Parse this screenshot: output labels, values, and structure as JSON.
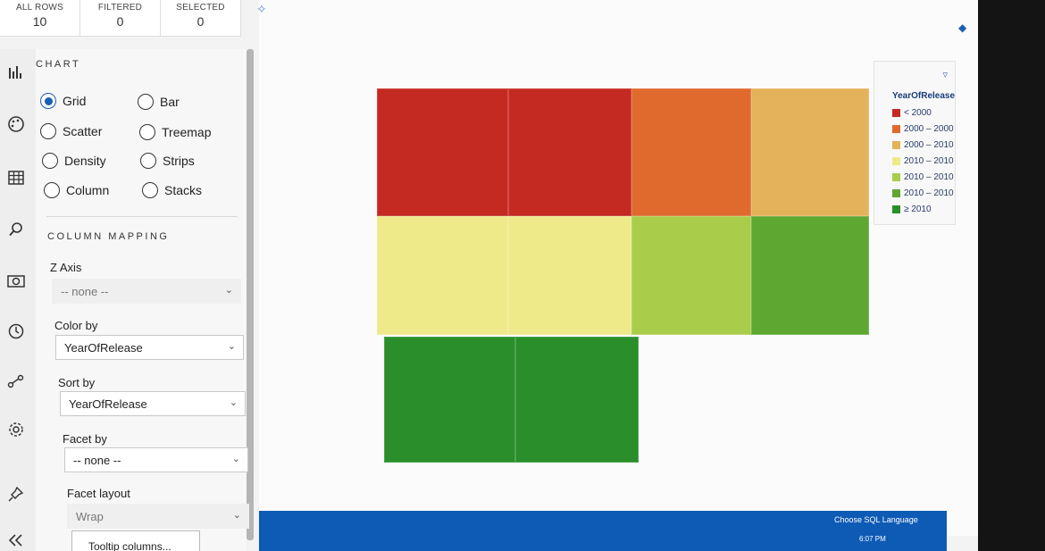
{
  "counters": {
    "all_rows": {
      "label": "ALL ROWS",
      "value": "10"
    },
    "filtered": {
      "label": "FILTERED",
      "value": "0"
    },
    "selected": {
      "label": "SELECTED",
      "value": "0"
    }
  },
  "sidebar_icons": [
    "chart-icon",
    "palette-icon",
    "table-icon",
    "search-icon",
    "camera-icon",
    "history-icon",
    "link-icon",
    "settings-icon",
    "pin-icon",
    "collapse-icon"
  ],
  "panel": {
    "chart_title": "CHART",
    "chart_types": [
      {
        "label": "Grid",
        "selected": true
      },
      {
        "label": "Bar",
        "selected": false
      },
      {
        "label": "Scatter",
        "selected": false
      },
      {
        "label": "Treemap",
        "selected": false
      },
      {
        "label": "Density",
        "selected": false
      },
      {
        "label": "Strips",
        "selected": false
      },
      {
        "label": "Column",
        "selected": false
      },
      {
        "label": "Stacks",
        "selected": false
      }
    ],
    "mapping_title": "COLUMN MAPPING",
    "z_axis": {
      "label": "Z Axis",
      "value": "-- none --"
    },
    "color_by": {
      "label": "Color by",
      "value": "YearOfRelease"
    },
    "sort_by": {
      "label": "Sort by",
      "value": "YearOfRelease"
    },
    "facet_by": {
      "label": "Facet by",
      "value": "-- none --"
    },
    "facet_layout": {
      "label": "Facet layout",
      "value": "Wrap"
    },
    "tooltip_button": "Tooltip columns..."
  },
  "chart_data": {
    "type": "heatmap",
    "rows": [
      [
        "< 2000",
        "< 2000",
        "2000 – 2000",
        "2000 – 2010"
      ],
      [
        "2010 – 2010",
        "2010 – 2010",
        "2010 – 2010",
        "2010 – 2010"
      ],
      [
        "≥ 2010",
        "≥ 2010"
      ]
    ],
    "legend_title": "YearOfRelease",
    "legend": [
      {
        "label": "< 2000",
        "color": "#c42a22"
      },
      {
        "label": "2000 – 2000",
        "color": "#e06a2e"
      },
      {
        "label": "2000 – 2010",
        "color": "#e4b25a"
      },
      {
        "label": "2010 – 2010",
        "color": "#eeea8a"
      },
      {
        "label": "2010 – 2010",
        "color": "#a9cd4a"
      },
      {
        "label": "2010 – 2010",
        "color": "#5ea832"
      },
      {
        "label": "≥ 2010",
        "color": "#2a8f2a"
      }
    ]
  },
  "taskbar": {
    "lang": "Choose SQL Language",
    "time": "6:07 PM"
  }
}
